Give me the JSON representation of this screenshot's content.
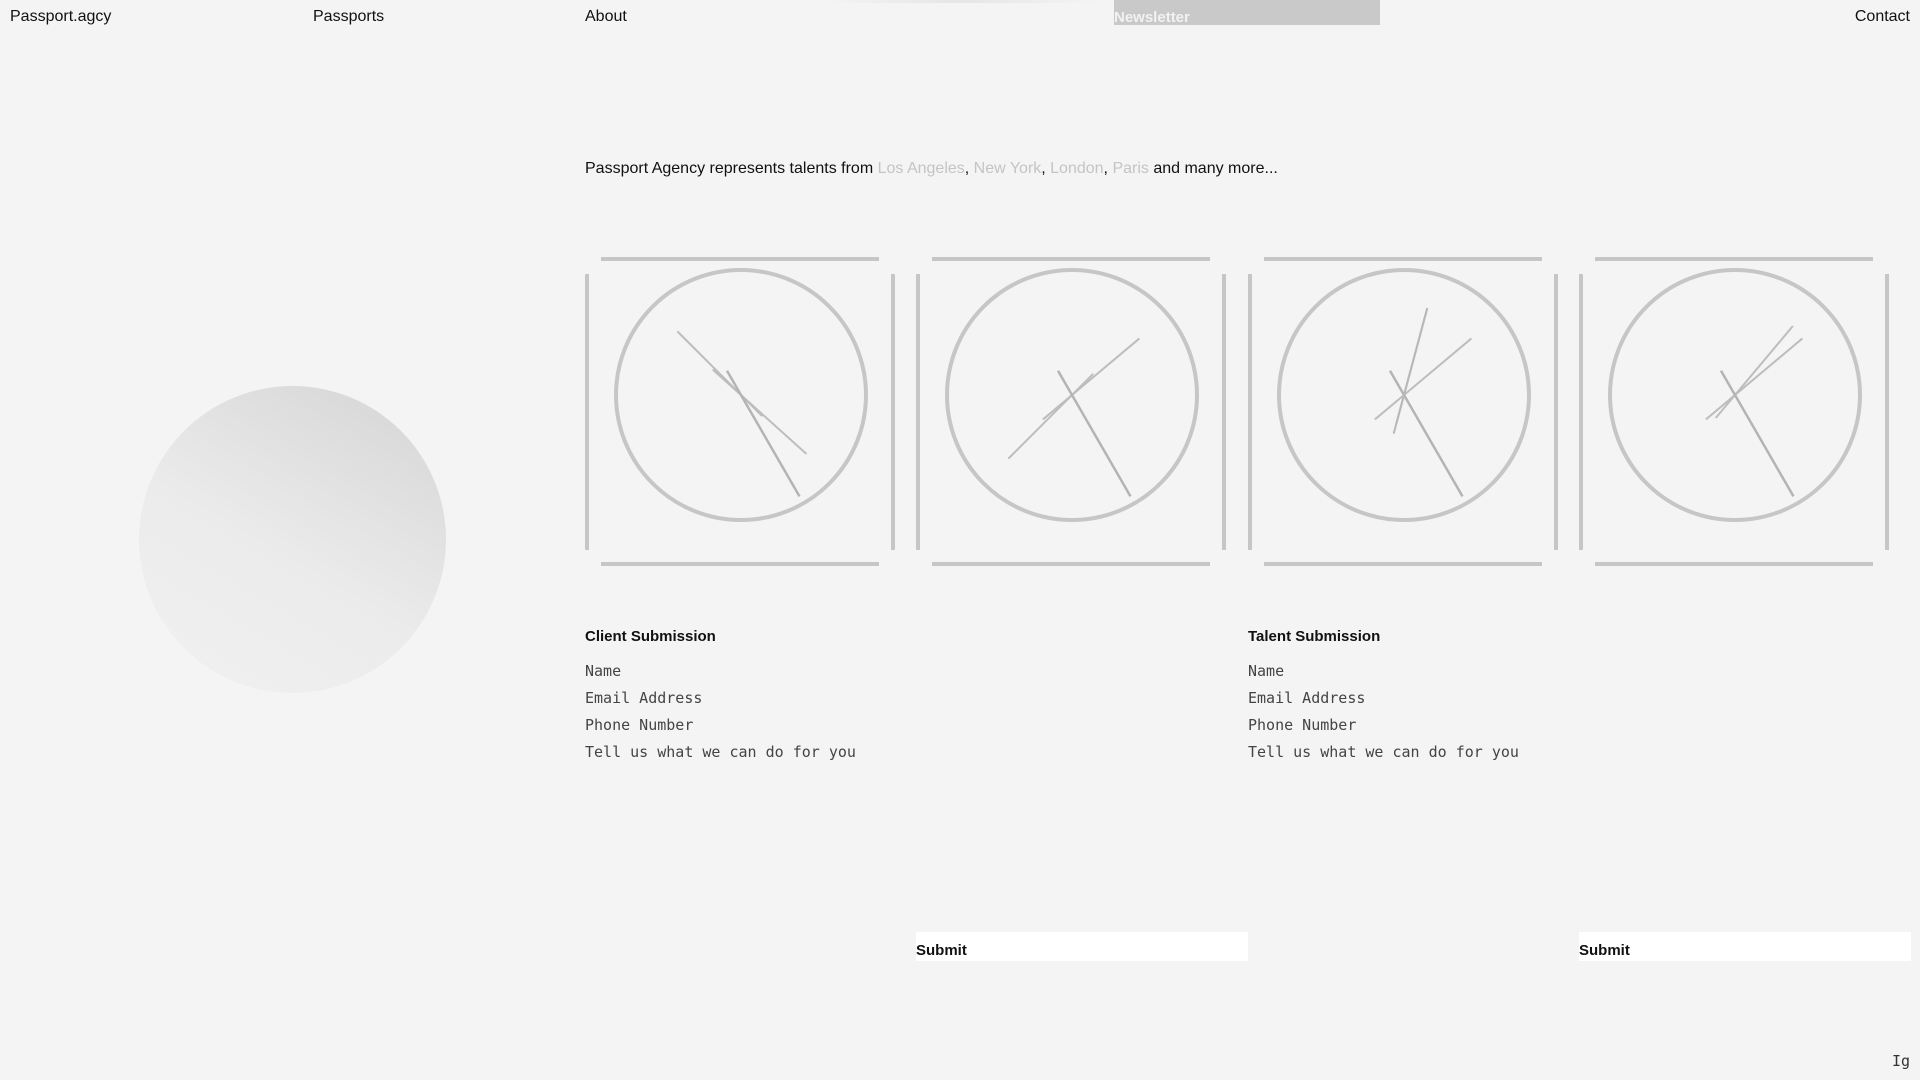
{
  "nav": {
    "logo": "Passport.agcy",
    "passports": "Passports",
    "about": "About",
    "newsletter": "Newsletter",
    "contact": "Contact"
  },
  "intro": {
    "prefix": "Passport Agency represents talents from ",
    "cities": [
      "Los Angeles",
      "New York",
      "London",
      "Paris"
    ],
    "sep": ", ",
    "suffix": " and many more..."
  },
  "clocks": [
    {
      "hour_deg": 315,
      "minute_deg": 132,
      "second_deg": 150,
      "extra_deg": null
    },
    {
      "hour_deg": 225,
      "minute_deg": 50,
      "second_deg": 150,
      "extra_deg": null
    },
    {
      "hour_deg": 15,
      "minute_deg": 50,
      "second_deg": 150,
      "extra_deg": 195
    },
    {
      "hour_deg": 40,
      "minute_deg": 50,
      "second_deg": 150,
      "extra_deg": null
    }
  ],
  "client_form": {
    "title": "Client Submission",
    "name_placeholder": "Name",
    "email_placeholder": "Email Address",
    "phone_placeholder": "Phone Number",
    "message_placeholder": "Tell us what we can do for you",
    "submit_label": "Submit"
  },
  "talent_form": {
    "title": "Talent Submission",
    "name_placeholder": "Name",
    "email_placeholder": "Email Address",
    "phone_placeholder": "Phone Number",
    "message_placeholder": "Tell us what we can do for you",
    "submit_label": "Submit"
  },
  "footer": {
    "instagram": "Ig"
  },
  "colors": {
    "background": "#f4f4f4",
    "frame": "#c6c6c6",
    "city_text": "#c4c4c4",
    "newsletter_bg": "#c9c9c9"
  }
}
